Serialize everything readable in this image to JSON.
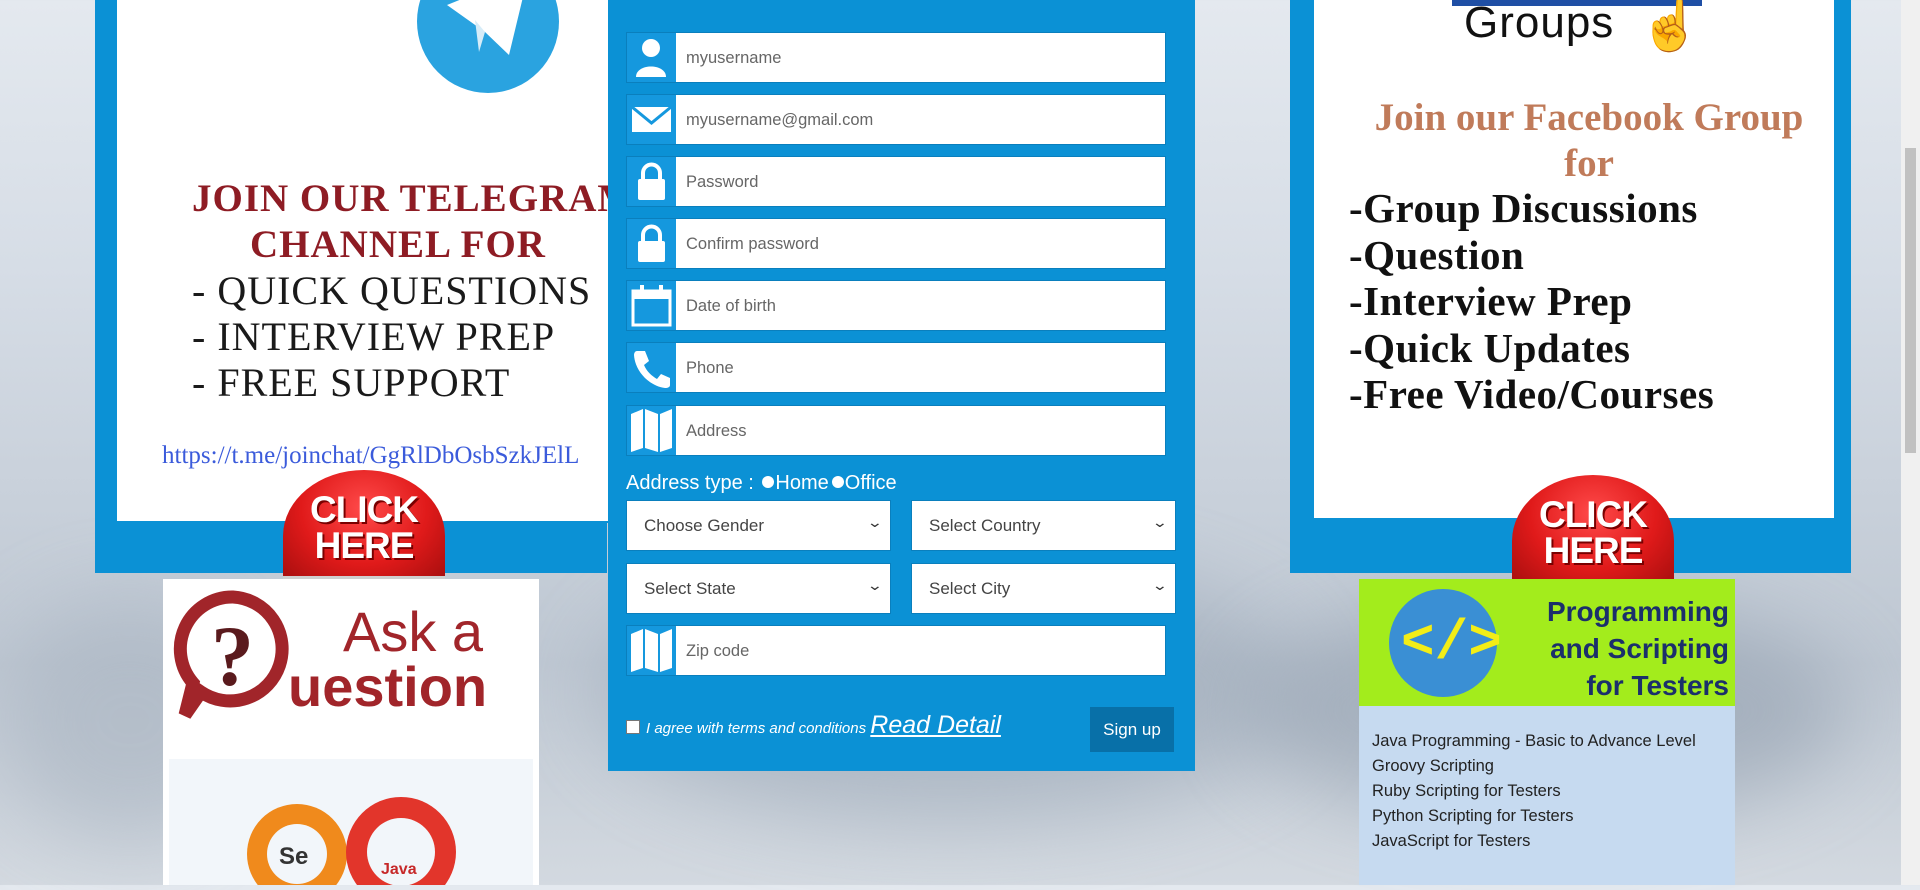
{
  "telegram_banner": {
    "title_line1": "JOIN OUR TELEGRAM",
    "title_line2": "CHANNEL  FOR",
    "items": [
      "- QUICK QUESTIONS",
      "- INTERVIEW PREP",
      "- FREE SUPPORT"
    ],
    "link": "https://t.me/joinchat/GgRlDbOsbSzkJElL",
    "click_here_line1": "CLICK",
    "click_here_line2": "HERE"
  },
  "facebook_banner": {
    "groups_label": "Groups",
    "join_line1": "Join our Facebook Group",
    "join_line2": "for",
    "items": [
      "-Group Discussions",
      "-Question",
      "-Interview Prep",
      "-Quick Updates",
      "-Free Video/Courses"
    ],
    "click_here_line1": "CLICK",
    "click_here_line2": "HERE"
  },
  "ask_question": {
    "line1": "Ask a",
    "line2": "uestion",
    "selenium_label": "Se",
    "java_label": "Java"
  },
  "programming": {
    "code_symbol": "</>",
    "title_line1": "Programming",
    "title_line2": "and Scripting",
    "title_line3": "for Testers",
    "items": [
      "Java Programming - Basic to Advance Level",
      "Groovy Scripting",
      "Ruby Scripting for Testers",
      "Python Scripting for Testers",
      "JavaScript for Testers"
    ]
  },
  "form": {
    "username_placeholder": "myusername",
    "email_placeholder": "myusername@gmail.com",
    "password_placeholder": "Password",
    "confirm_password_placeholder": "Confirm password",
    "dob_placeholder": "Date of birth",
    "phone_placeholder": "Phone",
    "address_placeholder": "Address",
    "address_type_label": "Address type :",
    "address_type_home": "Home",
    "address_type_office": "Office",
    "gender_select": "Choose Gender",
    "country_select": "Select Country",
    "state_select": "Select State",
    "city_select": "Select City",
    "zip_placeholder": "Zip code",
    "agree_text": "I agree with terms and conditions",
    "read_detail": "Read Detail",
    "signup_label": "Sign up"
  },
  "colors": {
    "panel_blue": "#0b91d5",
    "icon_blue": "#1598de",
    "banner_red": "#8e1c24",
    "fb_orange": "#c07b5a",
    "lime": "#a3ec1c"
  }
}
